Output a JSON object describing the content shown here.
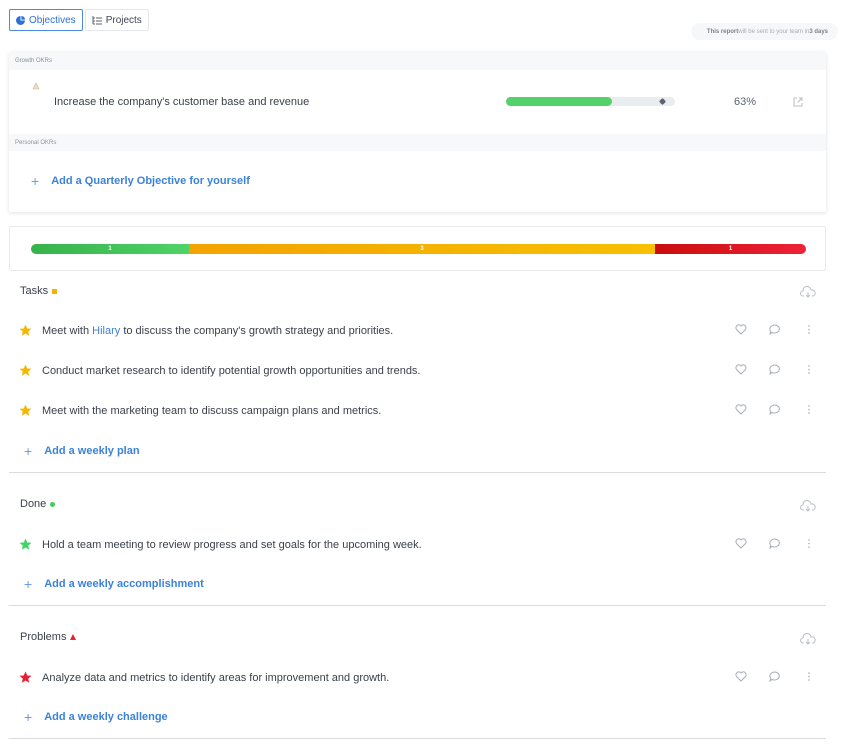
{
  "tabs": [
    {
      "label": "Objectives",
      "active": true,
      "icon": "pie-chart-icon"
    },
    {
      "label": "Projects",
      "active": false,
      "icon": "list-tree-icon"
    }
  ],
  "report_note": {
    "prefix": "This report",
    "middle": " will be sent to your team in ",
    "suffix": "3 days"
  },
  "okr": {
    "growth_label": "Growth OKRs",
    "objective": {
      "title": "Increase the company's customer base and revenue",
      "progress": 63,
      "percent_label": "63%"
    },
    "personal_label": "Personal OKRs",
    "add_label": "Add a Quarterly Objective for yourself"
  },
  "summary": {
    "segments": [
      {
        "label": "1",
        "color": "#4fd267"
      },
      {
        "label": "3",
        "color": "#f7c000"
      },
      {
        "label": "1",
        "color": "#ee2238"
      }
    ]
  },
  "tasks": {
    "title": "Tasks",
    "marker_color": "#f3b300",
    "star_color": "#f5b800",
    "items": [
      {
        "before": "Meet with ",
        "mention": "Hilary",
        "after": " to discuss the company's growth strategy and priorities."
      },
      {
        "before": "Conduct market research to identify potential growth opportunities and trends.",
        "mention": "",
        "after": ""
      },
      {
        "before": "Meet with the marketing team to discuss campaign plans and metrics.",
        "mention": "",
        "after": ""
      }
    ],
    "add_label": "Add a weekly plan"
  },
  "done": {
    "title": "Done",
    "marker_color": "#3fcf58",
    "star_color": "#45d364",
    "items": [
      {
        "before": "Hold a team meeting to review progress and set goals for the upcoming week.",
        "mention": "",
        "after": ""
      }
    ],
    "add_label": "Add a weekly accomplishment"
  },
  "problems": {
    "title": "Problems",
    "marker_color": "#e8202f",
    "star_color": "#e81f2d",
    "items": [
      {
        "before": "Analyze data and metrics to identify areas for improvement and growth.",
        "mention": "",
        "after": ""
      }
    ],
    "add_label": "Add a weekly challenge"
  },
  "plus_glyph": "+"
}
